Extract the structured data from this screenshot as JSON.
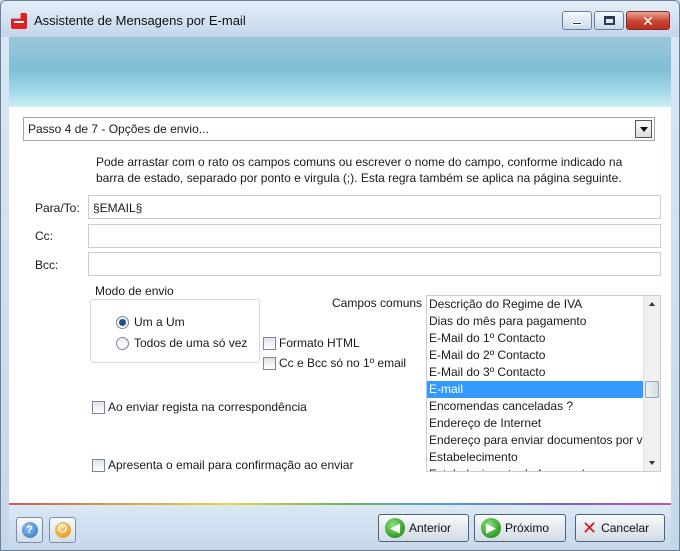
{
  "window": {
    "title": "Assistente de Mensagens por E-mail"
  },
  "step": {
    "selected": "Passo 4 de 7 - Opções de envio..."
  },
  "hint": {
    "line1": "Pode arrastar com o rato os campos comuns ou escrever  o nome do campo, conforme indicado na",
    "line2": "barra de estado, separado por ponto e virgula (;). Esta regra também se aplica na página seguinte."
  },
  "fields": {
    "to_label": "Para/To:",
    "to_value": "§EMAIL§",
    "cc_label": "Cc:",
    "cc_value": "",
    "bcc_label": "Bcc:",
    "bcc_value": ""
  },
  "send_mode": {
    "label": "Modo de envio",
    "option1": "Um a Um",
    "option2": "Todos de uma só vez",
    "selected": "Um a Um"
  },
  "options": {
    "html_format": "Formato HTML",
    "cc_bcc_first": "Cc e Bcc só no 1º email",
    "register_correspondence": "Ao enviar regista na correspondência",
    "confirm_before_send": "Apresenta o email para confirmação ao enviar"
  },
  "common_fields": {
    "label": "Campos comuns",
    "items": [
      "Descrição do Regime de IVA",
      "Dias do mês para pagamento",
      "E-Mail do 1º Contacto",
      "E-Mail do 2º Contacto",
      "E-Mail do 3º Contacto",
      "E-mail",
      "Encomendas canceladas ?",
      "Endereço de Internet",
      "Endereço para enviar documentos por v",
      "Estabelecimento",
      "Estabelecimento do fornecedor"
    ],
    "selected_index": 5,
    "scroll_fraction": 0.55
  },
  "footer": {
    "prev_label": "Anterior",
    "next_label": "Próximo",
    "cancel_label": "Cancelar"
  },
  "colors": {
    "selection": "#3399ff",
    "banner": "#7ec0d6",
    "close_button": "#c7452f"
  }
}
